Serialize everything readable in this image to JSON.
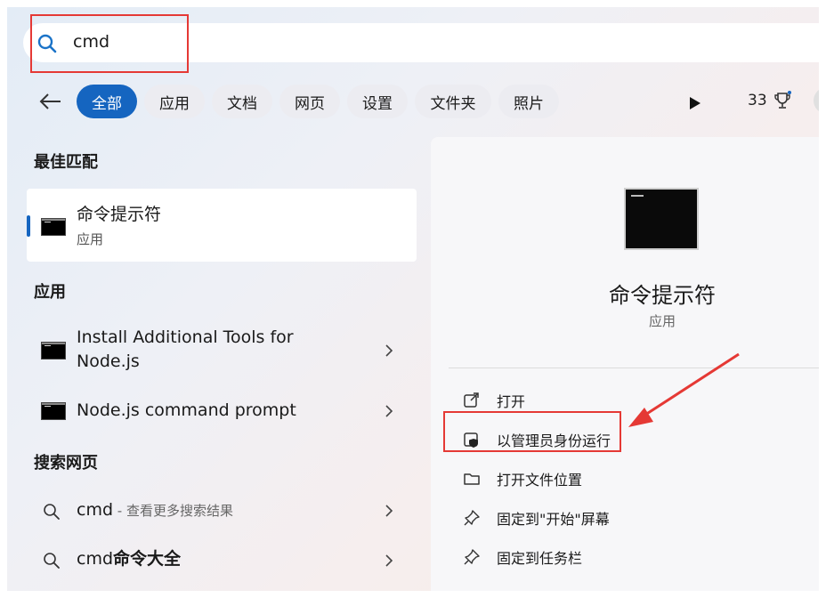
{
  "search": {
    "query": "cmd"
  },
  "filters": [
    {
      "label": "全部",
      "active": true
    },
    {
      "label": "应用"
    },
    {
      "label": "文档"
    },
    {
      "label": "网页"
    },
    {
      "label": "设置"
    },
    {
      "label": "文件夹"
    },
    {
      "label": "照片"
    }
  ],
  "header_right": {
    "count": "33"
  },
  "best_match": {
    "title": "最佳匹配",
    "name": "命令提示符",
    "type": "应用"
  },
  "apps": {
    "title": "应用",
    "items": [
      {
        "line1": "Install Additional Tools for",
        "line2": "Node.js"
      },
      {
        "line1": "Node.js command prompt"
      }
    ]
  },
  "web": {
    "title": "搜索网页",
    "items": [
      {
        "term": "cmd",
        "suffix": " - 查看更多搜索结果"
      },
      {
        "term": "cmd",
        "bold": "命令大全"
      }
    ]
  },
  "details": {
    "name": "命令提示符",
    "type": "应用",
    "actions": [
      {
        "label": "打开",
        "icon": "open-external-icon"
      },
      {
        "label": "以管理员身份运行",
        "icon": "shield-admin-icon"
      },
      {
        "label": "打开文件位置",
        "icon": "folder-icon"
      },
      {
        "label": "固定到\"开始\"屏幕",
        "icon": "pin-icon"
      },
      {
        "label": "固定到任务栏",
        "icon": "pin-icon"
      }
    ]
  },
  "colors": {
    "accent": "#1565c0",
    "highlight": "#e53935"
  }
}
